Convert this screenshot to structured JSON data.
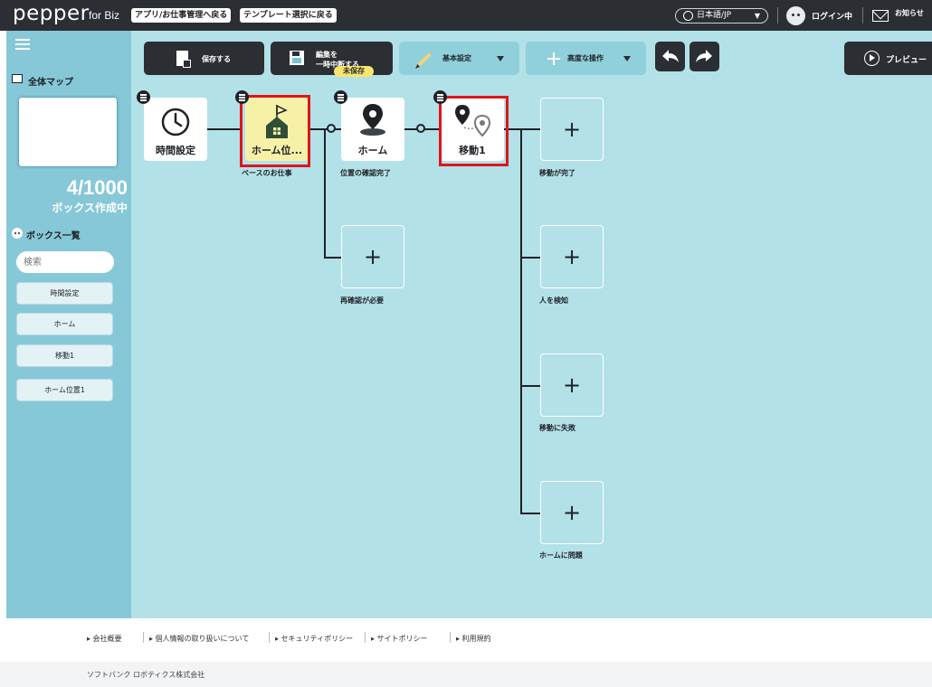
{
  "topbar": {
    "logo": "pepper",
    "logo_sub": "for Biz",
    "link_back": "アプリ/お仕事管理へ戻る",
    "link_template": "テンプレート選択に戻る",
    "language": "日本語/JP",
    "login_status": "ログイン中",
    "news": "お知らせ"
  },
  "sidebar": {
    "map_title": "全体マップ",
    "box_count": "4/1000",
    "box_count_sub": "ボックス作成中",
    "box_list_title": "ボックス一覧",
    "search_placeholder": "検索",
    "boxes": [
      {
        "label": "時間設定"
      },
      {
        "label": "ホーム"
      },
      {
        "label": "移動1"
      },
      {
        "label": "ホーム位置1"
      }
    ]
  },
  "toolbar": {
    "unsaved_badge": "未保存",
    "save": "保存する",
    "suspend_line1": "編集を",
    "suspend_line2": "一時中断する",
    "basic_settings": "基本設定",
    "advanced": "高度な操作",
    "preview": "プレビュー"
  },
  "flow": {
    "nodes": {
      "time": "時間設定",
      "home_pos": "ホーム位...",
      "home": "ホーム",
      "move": "移動1"
    },
    "labels": {
      "base_job": "ベースのお仕事",
      "pos_confirmed": "位置の確認完了",
      "reconfirm": "再確認が必要",
      "move_done": "移動が完了",
      "person_detected": "人を検知",
      "move_failed": "移動に失敗",
      "home_problem": "ホームに問題"
    },
    "plus": "+"
  },
  "footer": {
    "links": [
      {
        "label": "▸ 会社概要"
      },
      {
        "label": "▸ 個人情報の取り扱いについて"
      },
      {
        "label": "▸ セキュリティポリシー"
      },
      {
        "label": "▸ サイトポリシー"
      },
      {
        "label": "▸ 利用規約"
      }
    ],
    "copyright": "ソフトバンク ロボティクス株式会社"
  },
  "colors": {
    "topbar": "#2b2e33",
    "sidebar": "#87c8d8",
    "canvas": "#b3e1e8",
    "highlight": "#e0141b",
    "unsaved": "#f7e66b"
  },
  "icons": [
    "hamburger-icon",
    "map-icon",
    "clock-icon",
    "home-flag-icon",
    "location-pin-icon",
    "route-icon",
    "doc-save-icon",
    "floppy-icon",
    "pencil-icon",
    "plus-icon",
    "undo-icon",
    "redo-icon",
    "play-icon",
    "globe-icon",
    "mail-icon"
  ]
}
